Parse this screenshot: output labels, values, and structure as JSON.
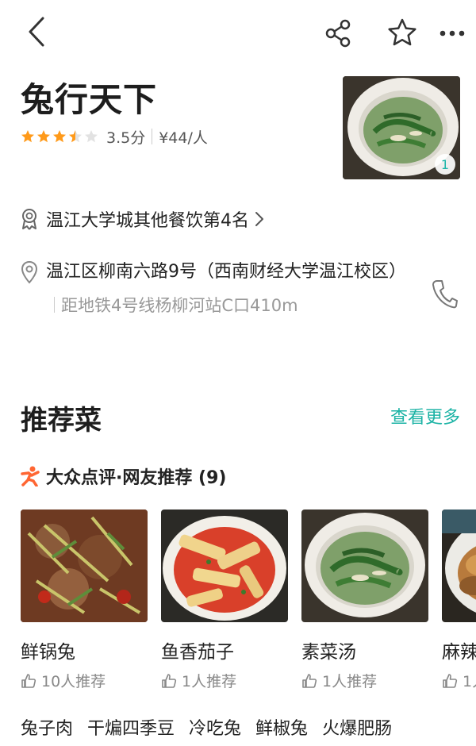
{
  "header": {
    "icons": [
      "back-arrow-icon",
      "share-icon",
      "star-outline-icon",
      "more-dots-icon"
    ]
  },
  "shop": {
    "name": "兔行天下",
    "rating_stars": 3.5,
    "score_text": "3.5分",
    "price_text": "¥44/人",
    "photo_count": "1"
  },
  "rank": {
    "text": "温江大学城其他餐饮第4名"
  },
  "address": {
    "text": "温江区柳南六路9号（西南财经大学温江校区）",
    "distance": "距地铁4号线杨柳河站C口410m"
  },
  "recommend": {
    "title": "推荐菜",
    "more_label": "查看更多",
    "source": "大众点评·网友推荐 (9)",
    "dishes": [
      {
        "name": "鲜锅兔",
        "recommend": "10人推荐"
      },
      {
        "name": "鱼香茄子",
        "recommend": "1人推荐"
      },
      {
        "name": "素菜汤",
        "recommend": "1人推荐"
      },
      {
        "name": "麻辣",
        "recommend": "1人"
      }
    ],
    "tags": [
      "兔子肉",
      "干煸四季豆",
      "冷吃兔",
      "鲜椒兔",
      "火爆肥肠"
    ]
  },
  "colors": {
    "accent": "#1cb3a5",
    "star": "#ff9a1a",
    "text": "#222222",
    "muted": "#888888"
  }
}
